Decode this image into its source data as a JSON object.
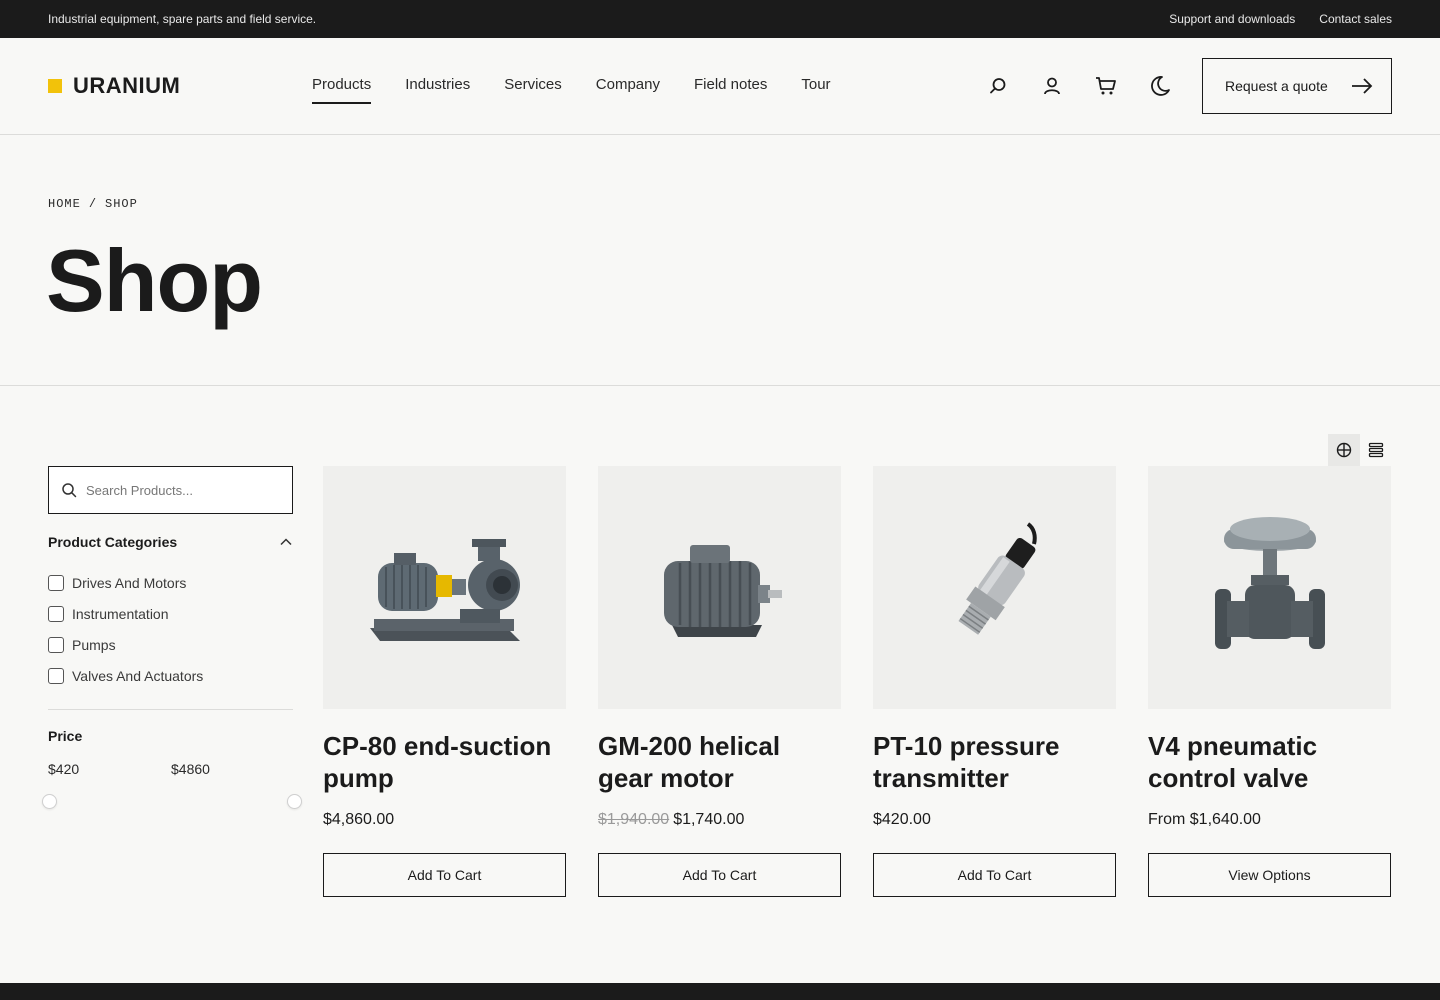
{
  "topbar": {
    "tagline": "Industrial equipment, spare parts and field service.",
    "links": [
      "Support and downloads",
      "Contact sales"
    ]
  },
  "brand": {
    "name": "URANIUM",
    "accent": "#f2c20a"
  },
  "nav": {
    "items": [
      "Products",
      "Industries",
      "Services",
      "Company",
      "Field notes",
      "Tour"
    ],
    "active": "Products"
  },
  "header_icons": [
    "search-icon",
    "user-icon",
    "cart-icon",
    "moon-icon"
  ],
  "quote_button": {
    "label": "Request a quote"
  },
  "breadcrumb": {
    "home": "HOME",
    "separator": "/",
    "current": "SHOP"
  },
  "page": {
    "title": "Shop"
  },
  "view_toggle": {
    "active": "grid"
  },
  "sidebar": {
    "search_placeholder": "Search Products...",
    "categories_title": "Product Categories",
    "categories": [
      "Drives And Motors",
      "Instrumentation",
      "Pumps",
      "Valves And Actuators"
    ],
    "price_title": "Price",
    "price_min": "$420",
    "price_max": "$4860"
  },
  "products": [
    {
      "name": "CP-80 end-suction pump",
      "price": "$4,860.00",
      "old_price": "",
      "button": "Add To Cart"
    },
    {
      "name": "GM-200 helical gear motor",
      "price": "$1,740.00",
      "old_price": "$1,940.00",
      "button": "Add To Cart"
    },
    {
      "name": "PT-10 pressure transmitter",
      "price": "$420.00",
      "old_price": "",
      "button": "Add To Cart"
    },
    {
      "name": "V4 pneumatic control valve",
      "price": "From $1,640.00",
      "old_price": "",
      "button": "View Options"
    }
  ]
}
